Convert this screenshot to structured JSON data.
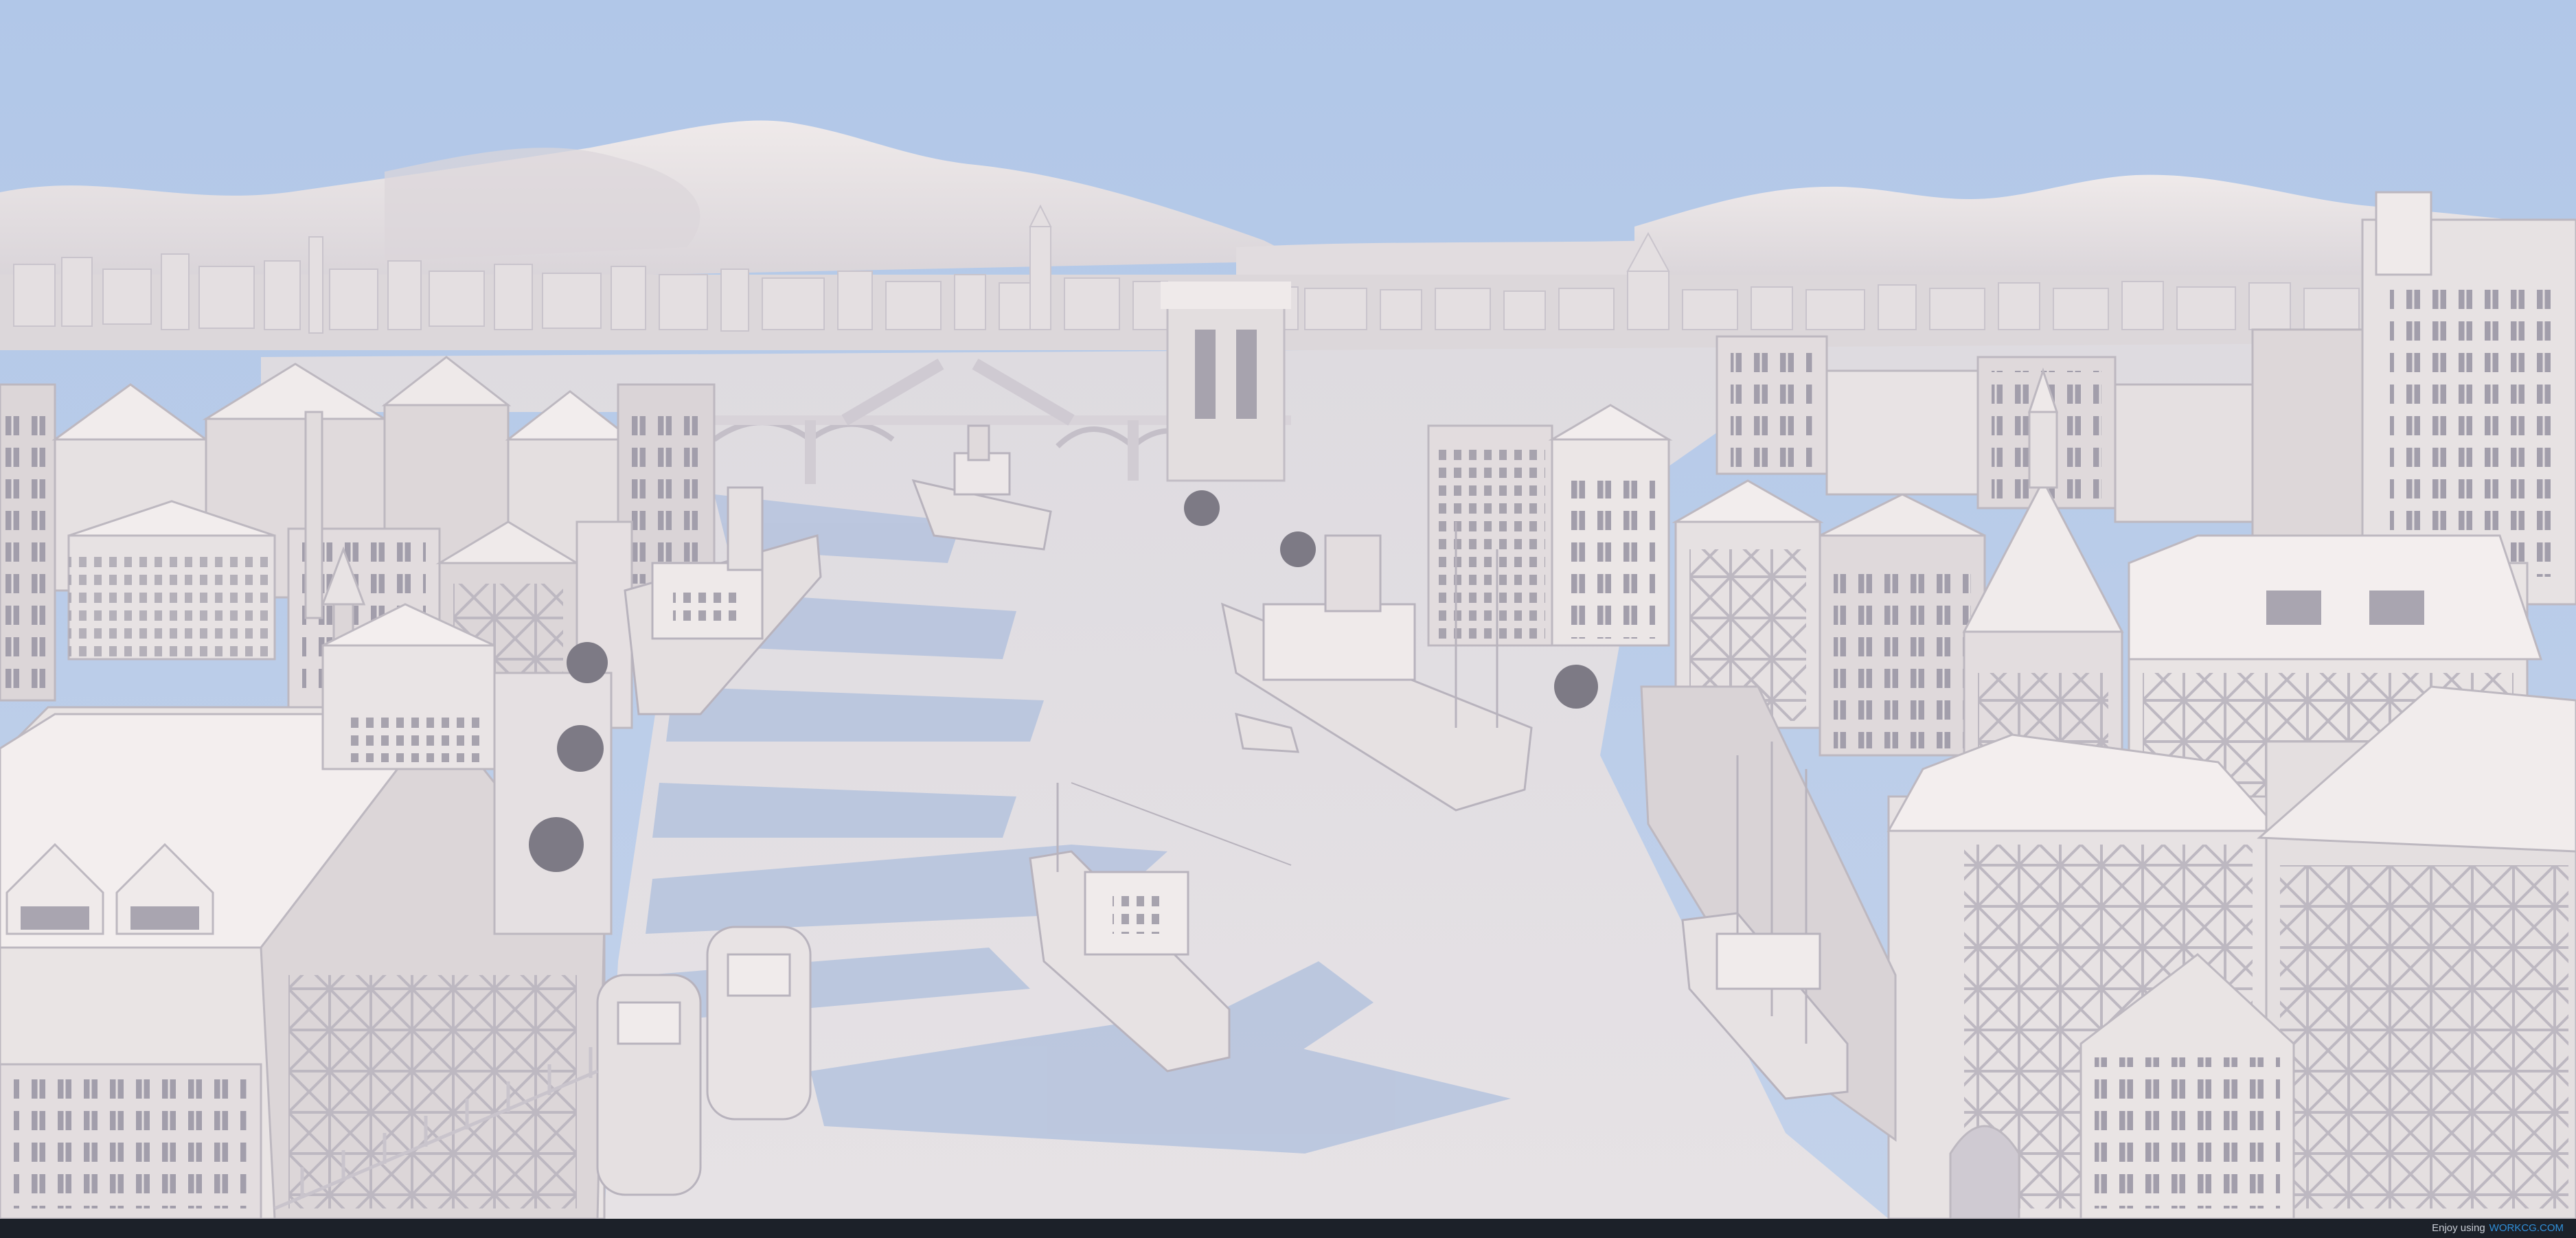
{
  "scene": {
    "description_kind": "render",
    "colors": {
      "sky": "#b4c9e6",
      "mountain": "#e8e3e4",
      "mountain_shade": "#d2cdd2",
      "water": "#dcd9de",
      "building_light": "#ebe6e6",
      "building_mid": "#dcd6d8",
      "building_shade": "#c3bec6",
      "roof": "#f2eded",
      "window": "#9c98a4",
      "shadow": "#aebddc",
      "footer": "#1c2129"
    }
  },
  "footer": {
    "credit_prefix": "Enjoy using",
    "credit_brand": "WORKCG.COM"
  }
}
